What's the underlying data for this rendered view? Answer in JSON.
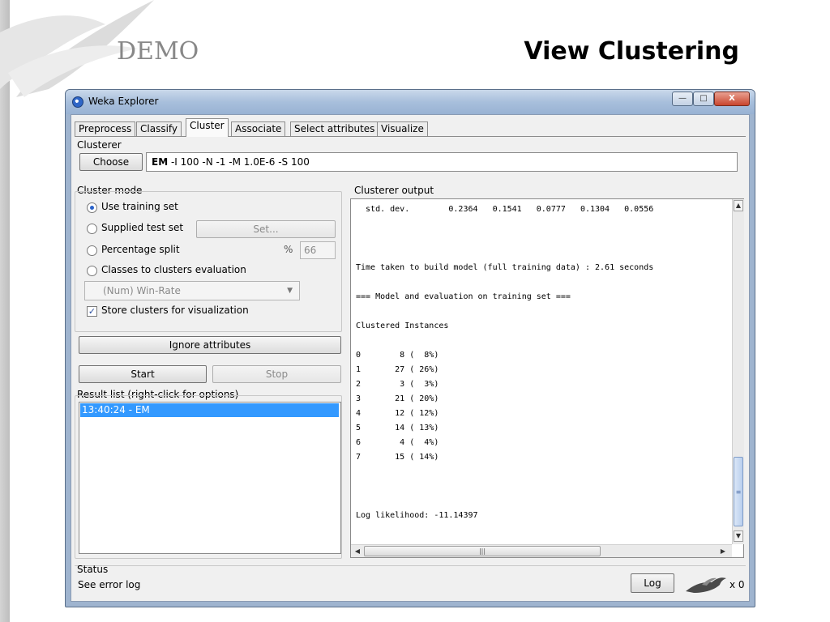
{
  "slide": {
    "demo_label": "DEMO",
    "title": "View Clustering"
  },
  "window": {
    "title": "Weka Explorer",
    "controls": {
      "minimize": "—",
      "maximize": "□",
      "close": "X"
    }
  },
  "tabs": [
    "Preprocess",
    "Classify",
    "Cluster",
    "Associate",
    "Select attributes",
    "Visualize"
  ],
  "active_tab": "Cluster",
  "clusterer": {
    "section_label": "Clusterer",
    "choose_label": "Choose",
    "algorithm": "EM",
    "options": " -I 100 -N -1 -M 1.0E-6 -S 100"
  },
  "cluster_mode": {
    "label": "Cluster mode",
    "use_training_set": "Use training set",
    "supplied_test_set": "Supplied test set",
    "set_button": "Set...",
    "percentage_split": "Percentage split",
    "percent_sign": "%",
    "percent_value": "66",
    "classes_to_clusters": "Classes to clusters evaluation",
    "class_attribute": "(Num) Win-Rate",
    "store_clusters": "Store clusters for visualization"
  },
  "buttons": {
    "ignore_attributes": "Ignore attributes",
    "start": "Start",
    "stop": "Stop"
  },
  "result_list": {
    "label": "Result list (right-click for options)",
    "items": [
      "13:40:24 - EM"
    ]
  },
  "output": {
    "label": "Clusterer output",
    "lines": [
      "  std. dev.        0.2364   0.1541   0.0777   0.1304   0.0556",
      "",
      "",
      "",
      "Time taken to build model (full training data) : 2.61 seconds",
      "",
      "=== Model and evaluation on training set ===",
      "",
      "Clustered Instances",
      "",
      "0        8 (  8%)",
      "1       27 ( 26%)",
      "2        3 (  3%)",
      "3       21 ( 20%)",
      "4       12 ( 12%)",
      "5       14 ( 13%)",
      "6        4 (  4%)",
      "7       15 ( 14%)",
      "",
      "",
      "",
      "Log likelihood: -11.14397"
    ]
  },
  "status": {
    "label": "Status",
    "text": "See error log",
    "log_button": "Log",
    "count": "x 0"
  },
  "icons": {
    "app": "weka-bird-icon",
    "status": "weka-bird-icon"
  }
}
